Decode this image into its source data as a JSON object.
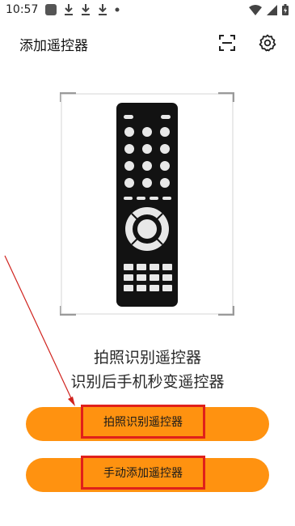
{
  "status_bar": {
    "time": "10:57",
    "notification_icons": [
      "app-square-icon",
      "download-icon",
      "download-icon",
      "download-icon",
      "dot-icon"
    ],
    "system_icons": [
      "wifi-icon",
      "signal-icon",
      "battery-icon"
    ]
  },
  "header": {
    "title": "添加遥控器",
    "actions": [
      "scan-icon",
      "settings-icon"
    ]
  },
  "illustration": {
    "subject": "remote-control-icon"
  },
  "headline": {
    "line1": "拍照识别遥控器",
    "line2": "识别后手机秒变遥控器"
  },
  "buttons": {
    "photo_recognize": "拍照识别遥控器",
    "manual_add": "手动添加遥控器"
  },
  "colors": {
    "accent": "#ff9210",
    "highlight_box": "#e0201b",
    "annotation_arrow": "#d0231e",
    "remote_body": "#121212"
  }
}
